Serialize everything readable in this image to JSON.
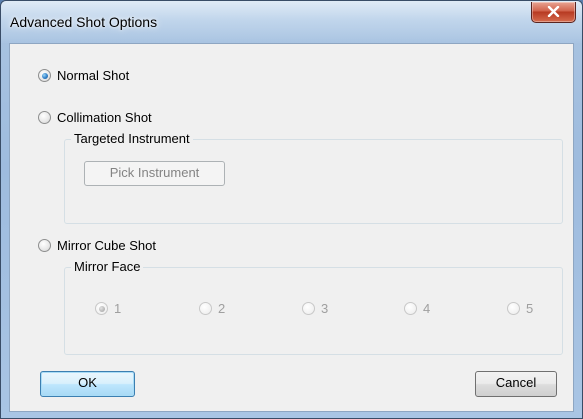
{
  "window": {
    "title": "Advanced Shot Options",
    "close_glyph": "X"
  },
  "shot_types": {
    "normal_label": "Normal Shot",
    "collimation_label": "Collimation Shot",
    "mirror_cube_label": "Mirror Cube Shot",
    "selected": "normal"
  },
  "targeted_instrument": {
    "group_label": "Targeted Instrument",
    "pick_button_label": "Pick Instrument",
    "enabled": false
  },
  "mirror_face": {
    "group_label": "Mirror Face",
    "options": [
      "1",
      "2",
      "3",
      "4",
      "5"
    ],
    "selected": "1",
    "enabled": false
  },
  "buttons": {
    "ok_label": "OK",
    "cancel_label": "Cancel"
  },
  "colors": {
    "title_bar": "#a7c2e0",
    "close_button": "#c8452c",
    "dialog_background": "#f0f0f0",
    "default_button_border": "#3c7fb1",
    "disabled_text": "#9f9f9f"
  },
  "icons": {
    "close": "close-icon"
  }
}
